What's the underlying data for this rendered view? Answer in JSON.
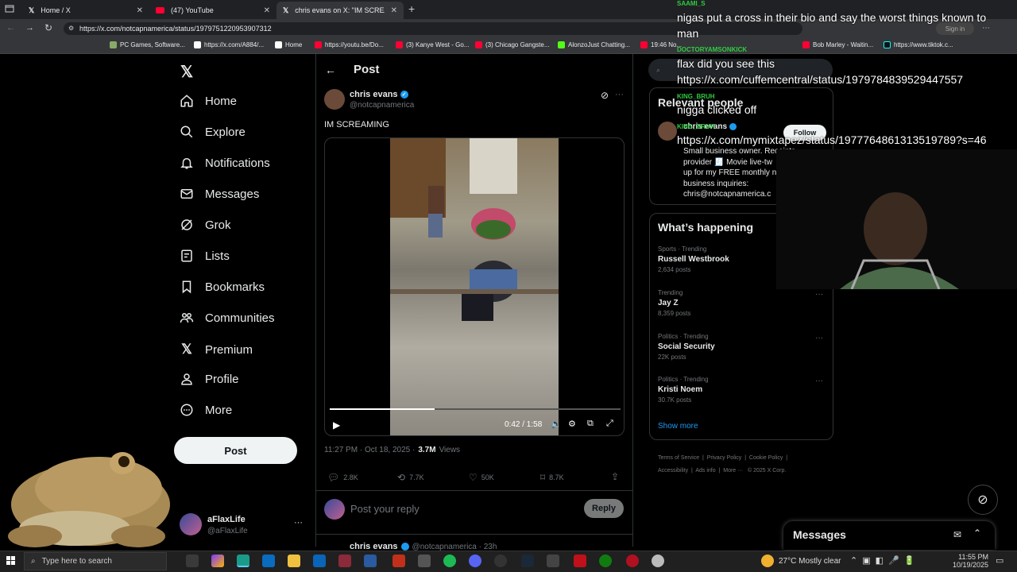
{
  "browser": {
    "tabs": [
      {
        "title": "Home / X"
      },
      {
        "title": "(47) YouTube"
      },
      {
        "title": "chris evans on X: \"IM SCREAMING"
      }
    ],
    "url": "https://x.com/notcapnamerica/status/1979751220953907312",
    "bookmarks": [
      "PC Games, Software...",
      "https://x.com/A884/...",
      "Home",
      "https://youtu.be/Do...",
      "(3) Kanye West - Go...",
      "(3) Chicago Gangste...",
      "AlonzoJust Chatting...",
      "19:46 No...",
      "Bob Marley - Waitin...",
      "https://www.tiktok.c..."
    ],
    "signin_label": "Sign in"
  },
  "sidebar": {
    "items": [
      {
        "label": "Home"
      },
      {
        "label": "Explore"
      },
      {
        "label": "Notifications"
      },
      {
        "label": "Messages"
      },
      {
        "label": "Grok"
      },
      {
        "label": "Lists"
      },
      {
        "label": "Bookmarks"
      },
      {
        "label": "Communities"
      },
      {
        "label": "Premium"
      },
      {
        "label": "Profile"
      },
      {
        "label": "More"
      }
    ],
    "post_button": "Post",
    "account": {
      "name": "aFlaxLife",
      "handle": "@aFlaxLife"
    }
  },
  "post": {
    "header_title": "Post",
    "author_name": "chris evans",
    "author_handle": "@notcapnamerica",
    "text": "IM SCREAMING",
    "video_time": "0:42 / 1:58",
    "video_progress": 0.36,
    "timestamp": "11:27 PM · Oct 18, 2025 ·",
    "views_count": "3.7M",
    "views_label": "Views",
    "replies": "2.8K",
    "reposts": "7.7K",
    "likes": "50K",
    "bookmarks": "8.7K",
    "reply_placeholder": "Post your reply",
    "reply_button": "Reply",
    "next_author": "chris evans",
    "next_handle": "@notcapnamerica · 23h"
  },
  "right": {
    "relevant_title": "Relevant people",
    "relevant_name": "chris evans",
    "relevant_bio": [
      "Small business owner. Receipts",
      "provider 🧾 Movie live-tw",
      "up for my FREE monthly n",
      "business inquiries:",
      "chris@notcapnamerica.c"
    ],
    "follow_label": "Follow",
    "whats_happening": "What’s happening",
    "trends": [
      {
        "category": "Sports · Trending",
        "name": "Russell Westbrook",
        "posts": "2,634 posts"
      },
      {
        "category": "Trending",
        "name": "Jay Z",
        "posts": "8,359 posts"
      },
      {
        "category": "Politics · Trending",
        "name": "Social Security",
        "posts": "22K posts"
      },
      {
        "category": "Politics · Trending",
        "name": "Kristi Noem",
        "posts": "30.7K posts"
      }
    ],
    "show_more": "Show more",
    "footer": [
      "Terms of Service",
      "Privacy Policy",
      "Cookie Policy",
      "Accessibility",
      "Ads info",
      "More ···",
      "© 2025 X Corp."
    ],
    "messages_label": "Messages"
  },
  "chat": [
    {
      "user": "SAAMI_S",
      "msg": "nigas put a cross in their bio and say the worst things known to man"
    },
    {
      "user": "",
      "msg": "flax did you see this"
    },
    {
      "user": "",
      "msg": "https://x.com/cuffemcentral/status/1979784839529447557"
    },
    {
      "user": "DOCTORYAMSONKICK",
      "msg": ""
    },
    {
      "user": "KING_BRUH",
      "msg": "nigga clicked off"
    },
    {
      "user": "KING_BRUH",
      "msg": "https://x.com/mymixtapez/status/1977764861313519789?s=46"
    }
  ],
  "taskbar": {
    "search_placeholder": "Type here to search",
    "weather": "27°C  Mostly clear",
    "time": "11:55 PM",
    "date": "10/19/2025"
  },
  "colors": {
    "accent": "#1d9bf0",
    "chat_user": "#2ecc40",
    "chrome_bg": "#202124"
  }
}
